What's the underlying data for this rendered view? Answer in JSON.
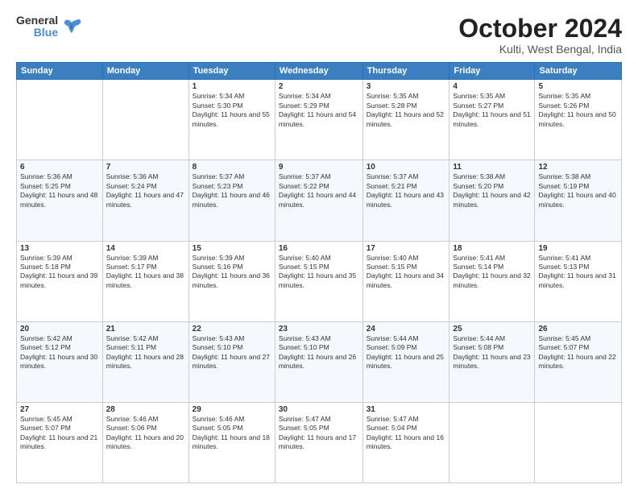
{
  "logo": {
    "general": "General",
    "blue": "Blue"
  },
  "header": {
    "month": "October 2024",
    "location": "Kulti, West Bengal, India"
  },
  "weekdays": [
    "Sunday",
    "Monday",
    "Tuesday",
    "Wednesday",
    "Thursday",
    "Friday",
    "Saturday"
  ],
  "weeks": [
    [
      {
        "day": "",
        "content": ""
      },
      {
        "day": "",
        "content": ""
      },
      {
        "day": "1",
        "content": "Sunrise: 5:34 AM\nSunset: 5:30 PM\nDaylight: 11 hours and 55 minutes."
      },
      {
        "day": "2",
        "content": "Sunrise: 5:34 AM\nSunset: 5:29 PM\nDaylight: 11 hours and 54 minutes."
      },
      {
        "day": "3",
        "content": "Sunrise: 5:35 AM\nSunset: 5:28 PM\nDaylight: 11 hours and 52 minutes."
      },
      {
        "day": "4",
        "content": "Sunrise: 5:35 AM\nSunset: 5:27 PM\nDaylight: 11 hours and 51 minutes."
      },
      {
        "day": "5",
        "content": "Sunrise: 5:35 AM\nSunset: 5:26 PM\nDaylight: 11 hours and 50 minutes."
      }
    ],
    [
      {
        "day": "6",
        "content": "Sunrise: 5:36 AM\nSunset: 5:25 PM\nDaylight: 11 hours and 48 minutes."
      },
      {
        "day": "7",
        "content": "Sunrise: 5:36 AM\nSunset: 5:24 PM\nDaylight: 11 hours and 47 minutes."
      },
      {
        "day": "8",
        "content": "Sunrise: 5:37 AM\nSunset: 5:23 PM\nDaylight: 11 hours and 46 minutes."
      },
      {
        "day": "9",
        "content": "Sunrise: 5:37 AM\nSunset: 5:22 PM\nDaylight: 11 hours and 44 minutes."
      },
      {
        "day": "10",
        "content": "Sunrise: 5:37 AM\nSunset: 5:21 PM\nDaylight: 11 hours and 43 minutes."
      },
      {
        "day": "11",
        "content": "Sunrise: 5:38 AM\nSunset: 5:20 PM\nDaylight: 11 hours and 42 minutes."
      },
      {
        "day": "12",
        "content": "Sunrise: 5:38 AM\nSunset: 5:19 PM\nDaylight: 11 hours and 40 minutes."
      }
    ],
    [
      {
        "day": "13",
        "content": "Sunrise: 5:39 AM\nSunset: 5:18 PM\nDaylight: 11 hours and 39 minutes."
      },
      {
        "day": "14",
        "content": "Sunrise: 5:39 AM\nSunset: 5:17 PM\nDaylight: 11 hours and 38 minutes."
      },
      {
        "day": "15",
        "content": "Sunrise: 5:39 AM\nSunset: 5:16 PM\nDaylight: 11 hours and 36 minutes."
      },
      {
        "day": "16",
        "content": "Sunrise: 5:40 AM\nSunset: 5:15 PM\nDaylight: 11 hours and 35 minutes."
      },
      {
        "day": "17",
        "content": "Sunrise: 5:40 AM\nSunset: 5:15 PM\nDaylight: 11 hours and 34 minutes."
      },
      {
        "day": "18",
        "content": "Sunrise: 5:41 AM\nSunset: 5:14 PM\nDaylight: 11 hours and 32 minutes."
      },
      {
        "day": "19",
        "content": "Sunrise: 5:41 AM\nSunset: 5:13 PM\nDaylight: 11 hours and 31 minutes."
      }
    ],
    [
      {
        "day": "20",
        "content": "Sunrise: 5:42 AM\nSunset: 5:12 PM\nDaylight: 11 hours and 30 minutes."
      },
      {
        "day": "21",
        "content": "Sunrise: 5:42 AM\nSunset: 5:11 PM\nDaylight: 11 hours and 28 minutes."
      },
      {
        "day": "22",
        "content": "Sunrise: 5:43 AM\nSunset: 5:10 PM\nDaylight: 11 hours and 27 minutes."
      },
      {
        "day": "23",
        "content": "Sunrise: 5:43 AM\nSunset: 5:10 PM\nDaylight: 11 hours and 26 minutes."
      },
      {
        "day": "24",
        "content": "Sunrise: 5:44 AM\nSunset: 5:09 PM\nDaylight: 11 hours and 25 minutes."
      },
      {
        "day": "25",
        "content": "Sunrise: 5:44 AM\nSunset: 5:08 PM\nDaylight: 11 hours and 23 minutes."
      },
      {
        "day": "26",
        "content": "Sunrise: 5:45 AM\nSunset: 5:07 PM\nDaylight: 11 hours and 22 minutes."
      }
    ],
    [
      {
        "day": "27",
        "content": "Sunrise: 5:45 AM\nSunset: 5:07 PM\nDaylight: 11 hours and 21 minutes."
      },
      {
        "day": "28",
        "content": "Sunrise: 5:46 AM\nSunset: 5:06 PM\nDaylight: 11 hours and 20 minutes."
      },
      {
        "day": "29",
        "content": "Sunrise: 5:46 AM\nSunset: 5:05 PM\nDaylight: 11 hours and 18 minutes."
      },
      {
        "day": "30",
        "content": "Sunrise: 5:47 AM\nSunset: 5:05 PM\nDaylight: 11 hours and 17 minutes."
      },
      {
        "day": "31",
        "content": "Sunrise: 5:47 AM\nSunset: 5:04 PM\nDaylight: 11 hours and 16 minutes."
      },
      {
        "day": "",
        "content": ""
      },
      {
        "day": "",
        "content": ""
      }
    ]
  ]
}
